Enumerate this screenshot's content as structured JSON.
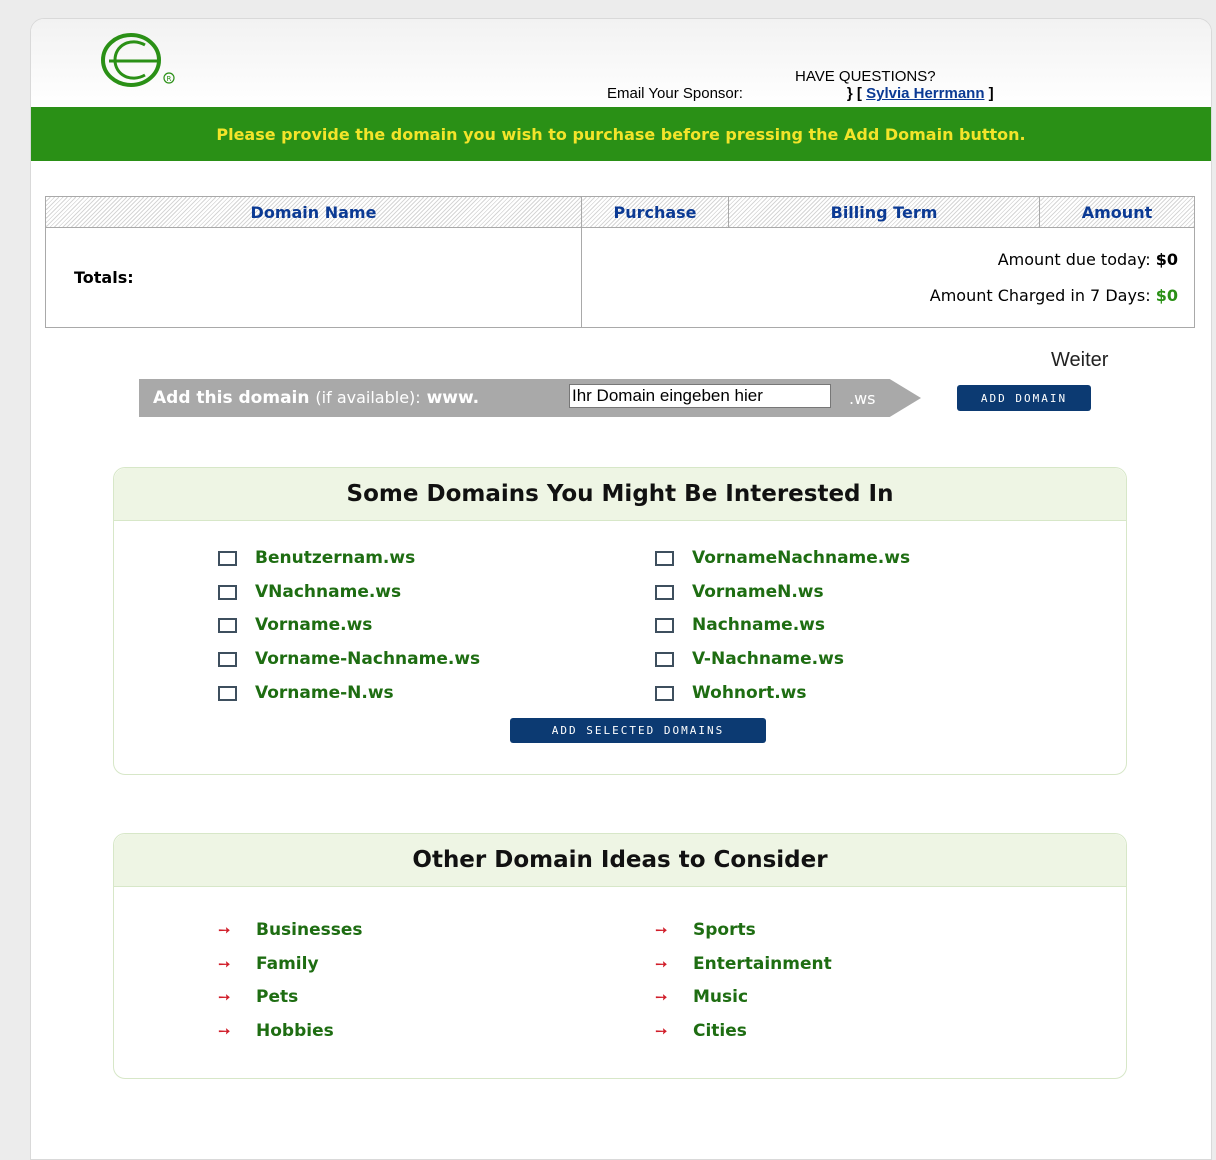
{
  "header": {
    "questions": "HAVE QUESTIONS?",
    "email_label": "Email Your Sponsor:",
    "bracket_open": "} [",
    "sponsor_name": "Sylvia Herrmann",
    "bracket_close": "]"
  },
  "banner": {
    "message": "Please provide the domain you wish to purchase before pressing the Add Domain button."
  },
  "cart": {
    "columns": [
      "Domain Name",
      "Purchase",
      "Billing Term",
      "Amount"
    ],
    "totals_label": "Totals:",
    "due_today_label": "Amount due today:",
    "due_today_value": "$0",
    "charged_label": "Amount Charged in 7 Days:",
    "charged_value": "$0"
  },
  "weiter": "Weiter",
  "add_domain": {
    "label_bold": "Add this domain",
    "label_light": "(if available):",
    "prefix": "www.",
    "input_value": "Ihr Domain eingeben hier",
    "suffix": ".ws",
    "button": "ADD DOMAIN"
  },
  "suggestions": {
    "title": "Some Domains You Might Be Interested In",
    "left": [
      "Benutzernam.ws",
      "VNachname.ws",
      "Vorname.ws",
      "Vorname-Nachname.ws",
      "Vorname-N.ws"
    ],
    "right": [
      "VornameNachname.ws",
      "VornameN.ws",
      "Nachname.ws",
      "V-Nachname.ws",
      "Wohnort.ws"
    ],
    "button": "ADD SELECTED DOMAINS"
  },
  "ideas": {
    "title": "Other Domain Ideas to Consider",
    "left": [
      "Businesses",
      "Family",
      "Pets",
      "Hobbies"
    ],
    "right": [
      "Sports",
      "Entertainment",
      "Music",
      "Cities"
    ]
  },
  "colors": {
    "banner_bg": "#2a9016",
    "banner_text": "#f3e42a",
    "link_green": "#1e6d12",
    "button_navy": "#0c3a72",
    "arrow_red": "#d11e2a"
  }
}
